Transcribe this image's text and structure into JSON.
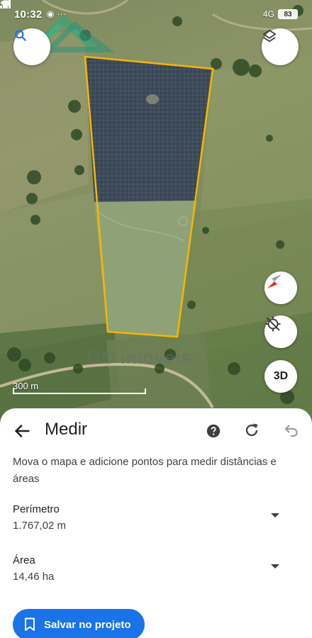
{
  "status_bar": {
    "time": "10:32",
    "notifications": "◉ ···",
    "network": "4G",
    "battery": "83"
  },
  "map": {
    "scale_label": "300 m",
    "watermark": "GC imoveis",
    "three_d_label": "3D",
    "polygon_color": "#f5b700"
  },
  "sheet": {
    "title": "Medir",
    "instruction": "Mova o mapa e adicione pontos para medir distâncias e áreas",
    "perimeter_label": "Perímetro",
    "perimeter_value": "1.767,02 m",
    "area_label": "Área",
    "area_value": "14,46 ha",
    "save_label": "Salvar no projeto"
  },
  "colors": {
    "accent": "#1a73e8"
  }
}
